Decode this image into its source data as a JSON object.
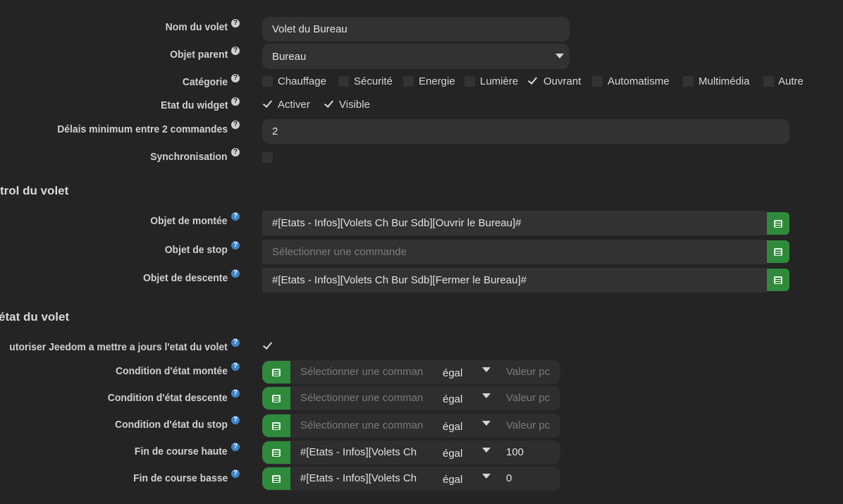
{
  "general": {
    "name_label": "Nom du volet",
    "name_value": "Volet du Bureau",
    "parent_label": "Objet parent",
    "parent_value": "Bureau",
    "category_label": "Catégorie",
    "categories": [
      {
        "label": "Chauffage",
        "checked": false
      },
      {
        "label": "Sécurité",
        "checked": false
      },
      {
        "label": "Energie",
        "checked": false
      },
      {
        "label": "Lumière",
        "checked": false
      },
      {
        "label": "Ouvrant",
        "checked": true
      },
      {
        "label": "Automatisme",
        "checked": false
      },
      {
        "label": "Multimédia",
        "checked": false
      },
      {
        "label": "Autre",
        "checked": false
      }
    ],
    "widget_label": "Etat du widget",
    "widget_activer": "Activer",
    "widget_visible": "Visible",
    "delay_label": "Délais minimum entre 2 commandes",
    "delay_value": "2",
    "sync_label": "Synchronisation",
    "help_glyph": "?"
  },
  "control": {
    "section_title": "trol du volet",
    "up_label": "Objet de montée",
    "up_value": "#[Etats - Infos][Volets Ch Bur Sdb][Ouvrir le  Bureau]#",
    "stop_label": "Objet de stop",
    "stop_placeholder": "Sélectionner une commande",
    "down_label": "Objet de descente",
    "down_value": "#[Etats - Infos][Volets Ch Bur Sdb][Fermer le Bureau]#"
  },
  "state": {
    "section_title": "état du volet",
    "allow_label": "utoriser Jeedom a mettre a jours l'etat du volet",
    "conditions": [
      {
        "label": "Condition d'état montée",
        "command": "Sélectionner une comman",
        "command_placeholder": true,
        "operator": "égal",
        "value": "Valeur pc",
        "value_placeholder": true
      },
      {
        "label": "Condition d'état descente",
        "command": "Sélectionner une comman",
        "command_placeholder": true,
        "operator": "égal",
        "value": "Valeur pc",
        "value_placeholder": true
      },
      {
        "label": "Condition d'état du stop",
        "command": "Sélectionner une comman",
        "command_placeholder": true,
        "operator": "égal",
        "value": "Valeur pc",
        "value_placeholder": true
      },
      {
        "label": "Fin de course haute",
        "command": "#[Etats - Infos][Volets Ch",
        "command_placeholder": false,
        "operator": "égal",
        "value": "100",
        "value_placeholder": false
      },
      {
        "label": "Fin de course basse",
        "command": "#[Etats - Infos][Volets Ch",
        "command_placeholder": false,
        "operator": "égal",
        "value": "0",
        "value_placeholder": false
      }
    ]
  },
  "colors": {
    "background": "#242424",
    "field": "#323232",
    "accent_green": "#2f8a3c",
    "help_blue": "#3d84c6"
  },
  "icons": {
    "help": "question-circle-icon",
    "command_list": "list-alt-icon",
    "dropdown": "caret-down-icon",
    "check": "check-icon"
  }
}
